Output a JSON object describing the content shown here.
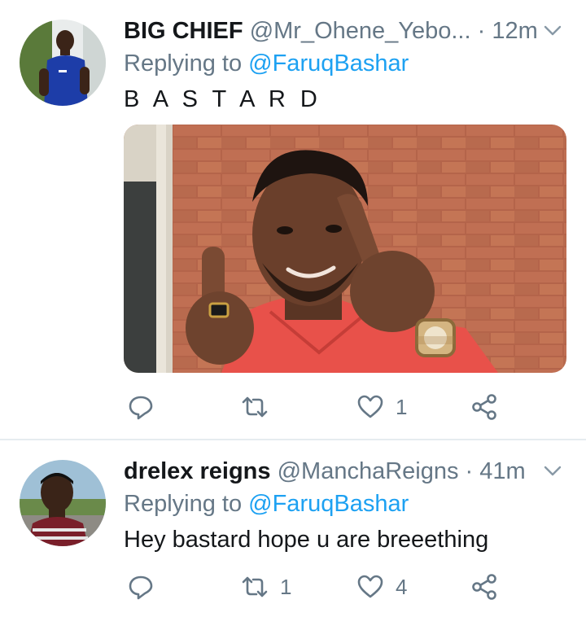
{
  "tweets": [
    {
      "name": "BIG CHIEF",
      "handle": "@Mr_Ohene_Yebo...",
      "dot": "·",
      "time": "12m",
      "replying_prefix": "Replying to ",
      "replying_to": "@FaruqBashar",
      "text": "B A S T A R D",
      "replies": "",
      "retweets": "",
      "likes": "1",
      "has_media": true
    },
    {
      "name": "drelex reigns",
      "handle": "@ManchaReigns",
      "dot": "·",
      "time": "41m",
      "replying_prefix": "Replying to ",
      "replying_to": "@FaruqBashar",
      "text": "Hey bastard hope u are breeething",
      "replies": "",
      "retweets": "1",
      "likes": "4",
      "has_media": false
    }
  ],
  "colors": {
    "text": "#14171a",
    "secondary": "#657786",
    "link": "#1da1f2",
    "divider": "#e6ecf0"
  },
  "icons": [
    "reply-icon",
    "retweet-icon",
    "like-icon",
    "share-icon",
    "chevron-down-icon"
  ]
}
